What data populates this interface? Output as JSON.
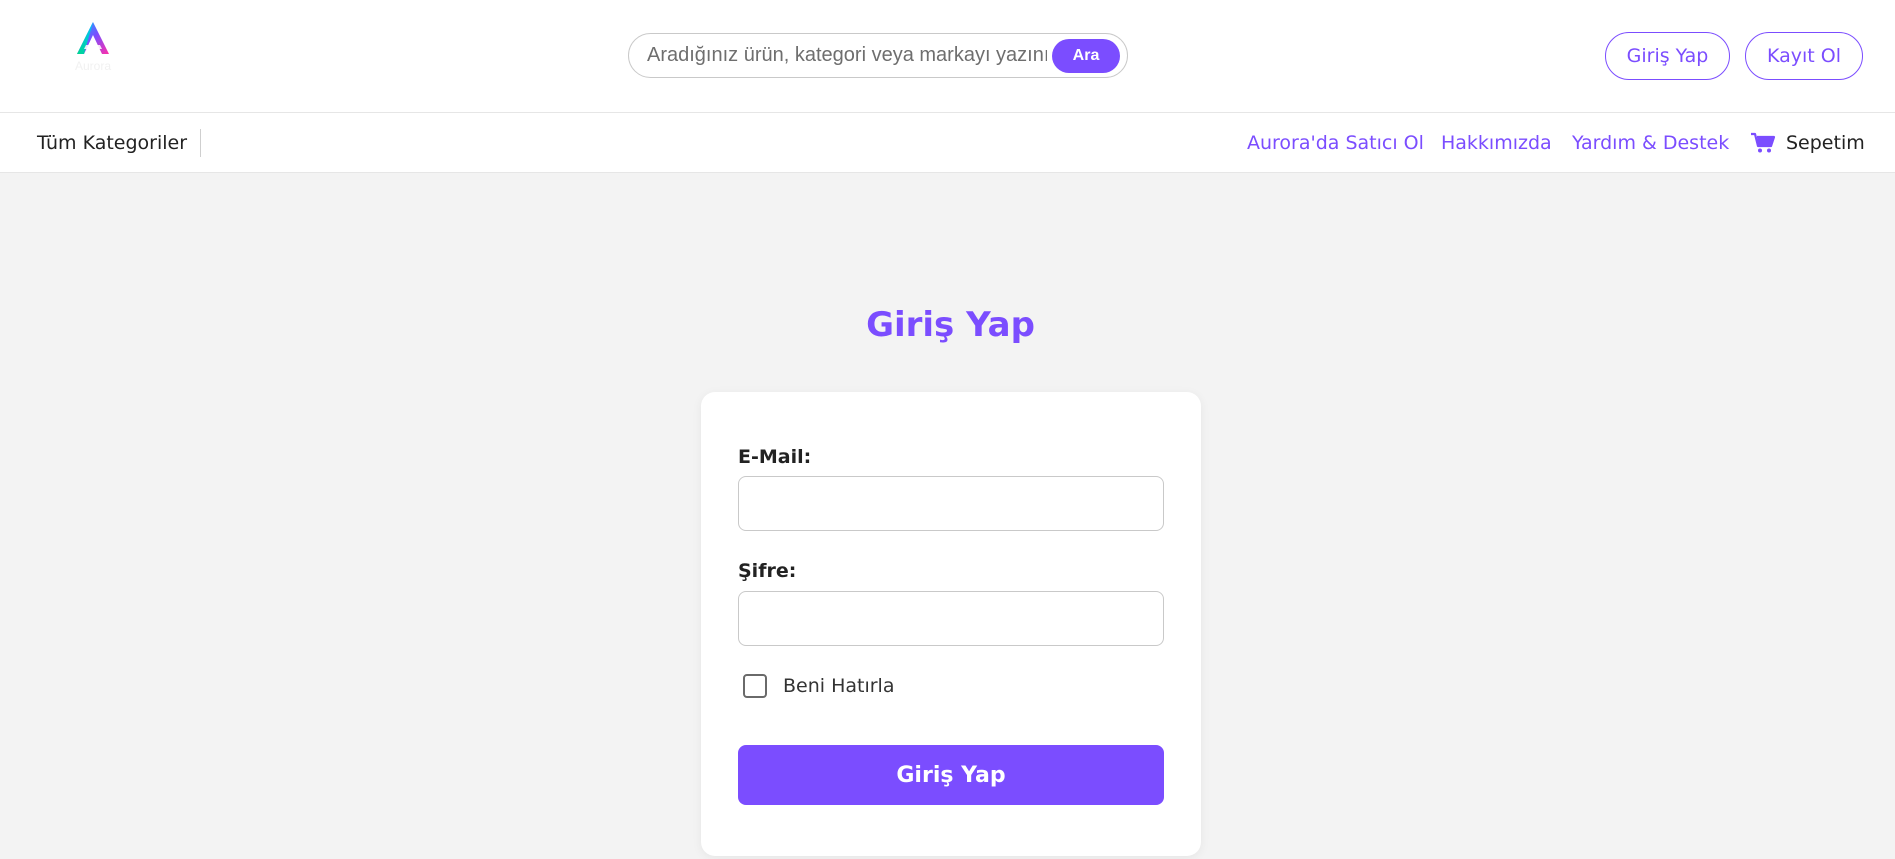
{
  "brand": {
    "name": "Aurora",
    "accent": "#7b4dff"
  },
  "search": {
    "placeholder": "Aradığınız ürün, kategori veya markayı yazınız",
    "button_label": "Ara",
    "icon": "search-icon"
  },
  "header": {
    "login_label": "Giriş Yap",
    "register_label": "Kayıt Ol"
  },
  "nav": {
    "categories_label": "Tüm Kategoriler",
    "links": [
      {
        "label": "Aurora'da Satıcı Ol"
      },
      {
        "label": "Hakkımızda"
      },
      {
        "label": "Yardım & Destek"
      }
    ],
    "cart": {
      "label": "Sepetim",
      "icon": "cart-icon"
    }
  },
  "login": {
    "title": "Giriş Yap",
    "email_label": "E-Mail:",
    "email_value": "",
    "password_label": "Şifre:",
    "password_value": "",
    "remember_label": "Beni Hatırla",
    "remember_checked": false,
    "submit_label": "Giriş Yap"
  }
}
